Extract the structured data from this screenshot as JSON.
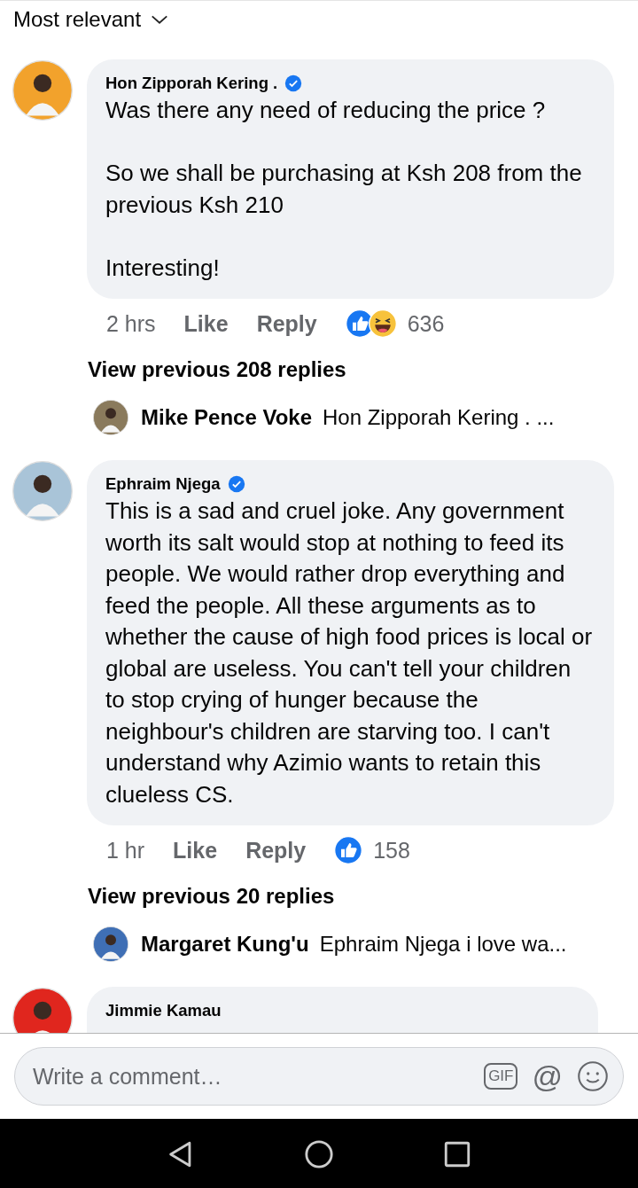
{
  "sort": {
    "label": "Most relevant"
  },
  "comments": [
    {
      "author": "Hon Zipporah Kering .",
      "verified": true,
      "color": "#f2a22c",
      "text": "Was there any need of reducing the price ?\n\nSo we shall be purchasing at Ksh 208 from the previous Ksh 210\n\nInteresting!",
      "time": "2 hrs",
      "actions": [
        "Like",
        "Reply"
      ],
      "reactions": [
        {
          "kind": "like"
        },
        {
          "kind": "haha"
        }
      ],
      "reaction_count": "636",
      "more_replies": "View previous 208 replies",
      "reply_preview": {
        "author": "Mike Pence Voke",
        "text": "Hon Zipporah Kering . ...",
        "color": "#8a7a5c"
      }
    },
    {
      "author": "Ephraim Njega",
      "verified": true,
      "color": "#a9c4d8",
      "text": "This is a sad and cruel joke. Any government worth its salt would stop at nothing to feed its people. We would rather drop everything and feed the people. All these arguments as to whether the cause of high food prices is local or global are useless. You can't tell your children to stop crying of hunger because the neighbour's children are starving too. I can't understand why Azimio wants to retain this clueless CS.",
      "time": "1 hr",
      "actions": [
        "Like",
        "Reply"
      ],
      "reactions": [
        {
          "kind": "like"
        }
      ],
      "reaction_count": "158",
      "more_replies": "View previous 20 replies",
      "reply_preview": {
        "author": "Margaret Kung'u",
        "text": "Ephraim Njega i love wa...",
        "color": "#3f6fb5"
      }
    },
    {
      "author": "Jimmie Kamau",
      "verified": false,
      "color": "#e0261e"
    }
  ],
  "composer": {
    "placeholder": "Write a comment…",
    "buttons": [
      {
        "kind": "gif",
        "label": "GIF"
      },
      {
        "kind": "mention",
        "label": "@"
      },
      {
        "kind": "emoji"
      }
    ]
  },
  "nav_bar": [
    {
      "kind": "back"
    },
    {
      "kind": "home"
    },
    {
      "kind": "recents"
    }
  ]
}
